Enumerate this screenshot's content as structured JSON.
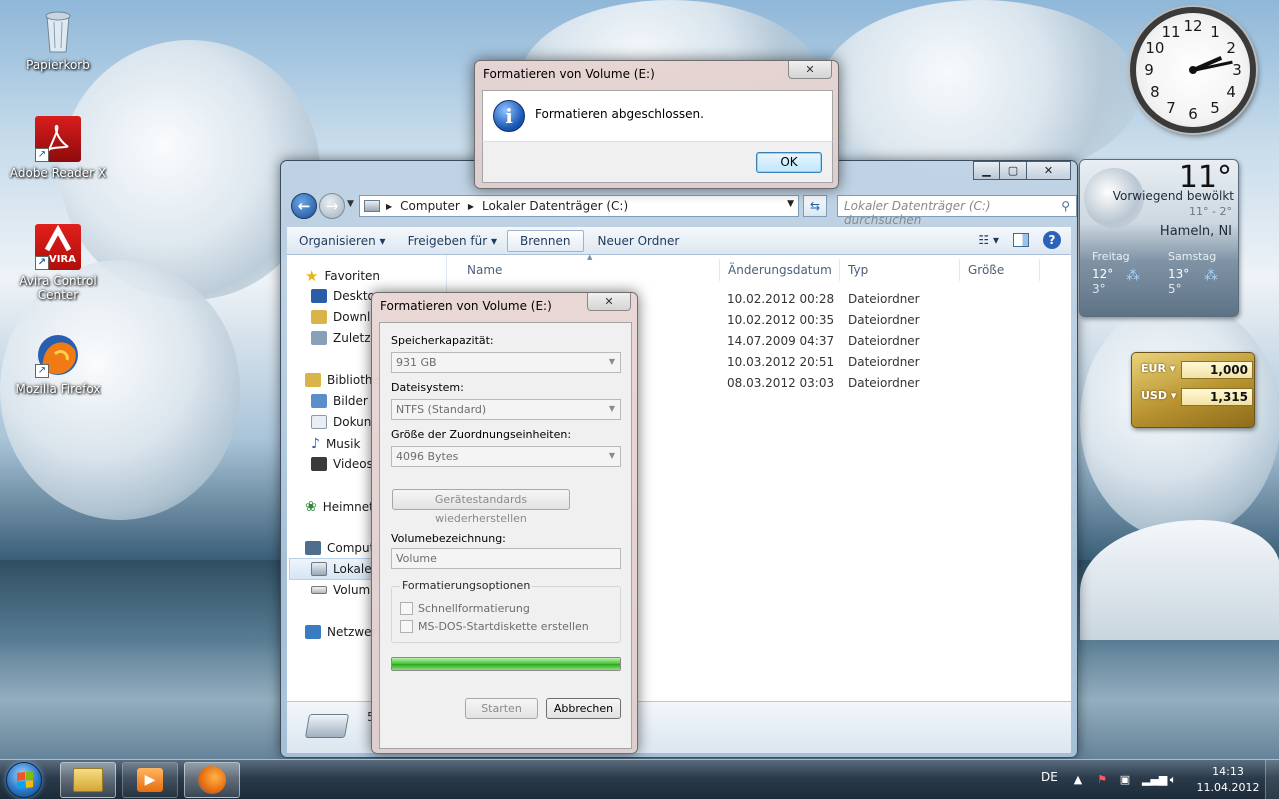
{
  "desktop": {
    "icons": [
      {
        "label": "Papierkorb",
        "icon": "recycle-bin-icon"
      },
      {
        "label": "Adobe Reader X",
        "icon": "adobe-reader-icon"
      },
      {
        "label": "Avira Control Center",
        "icon": "avira-icon",
        "badge": "VIRA"
      },
      {
        "label": "Mozilla Firefox",
        "icon": "firefox-icon"
      }
    ]
  },
  "explorer": {
    "address": {
      "parts": [
        "Computer",
        "Lokaler Datenträger (C:)"
      ]
    },
    "search_placeholder": "Lokaler Datenträger (C:) durchsuchen",
    "toolbar": {
      "organize": "Organisieren",
      "share": "Freigeben für",
      "burn": "Brennen",
      "new_folder": "Neuer Ordner"
    },
    "nav": {
      "favorites": "Favoriten",
      "desktop": "Deskto",
      "downloads": "Downl",
      "recent": "Zuletz",
      "libraries": "Bibliothe",
      "pictures": "Bilder",
      "documents": "Dokun",
      "music": "Musik",
      "videos": "Videos",
      "homegroup": "Heimnet",
      "computer": "Comput",
      "local_disk": "Lokale",
      "volume": "Volum",
      "network": "Netzwer"
    },
    "columns": {
      "name": "Name",
      "date": "Änderungsdatum",
      "type": "Typ",
      "size": "Größe"
    },
    "rows": [
      {
        "date": "10.02.2012 00:28",
        "type": "Dateiordner"
      },
      {
        "date": "10.02.2012 00:35",
        "type": "Dateiordner"
      },
      {
        "date": "14.07.2009 04:37",
        "type": "Dateiordner"
      },
      {
        "date": "10.03.2012 20:51",
        "type": "Dateiordner"
      },
      {
        "date": "08.03.2012 03:03",
        "type": "Dateiordner"
      }
    ],
    "status_count": "5"
  },
  "format_dialog": {
    "title": "Formatieren von Volume (E:)",
    "capacity_label": "Speicherkapazität:",
    "capacity_value": "931 GB",
    "filesystem_label": "Dateisystem:",
    "filesystem_value": "NTFS (Standard)",
    "alloc_label": "Größe der Zuordnungseinheiten:",
    "alloc_value": "4096 Bytes",
    "restore_defaults": "Gerätestandards wiederherstellen",
    "volume_label_label": "Volumebezeichnung:",
    "volume_label_value": "Volume",
    "options_group": "Formatierungsoptionen",
    "quick_format": "Schnellformatierung",
    "msdos_disk": "MS-DOS-Startdiskette erstellen",
    "progress": 1.0,
    "start": "Starten",
    "cancel": "Abbrechen"
  },
  "message_box": {
    "title": "Formatieren von Volume (E:)",
    "text": "Formatieren abgeschlossen.",
    "ok": "OK"
  },
  "clock": {
    "numbers": [
      "12",
      "1",
      "2",
      "3",
      "4",
      "5",
      "6",
      "7",
      "8",
      "9",
      "10",
      "11"
    ],
    "time": "14:13"
  },
  "weather": {
    "temp": "11°",
    "desc": "Vorwiegend bewölkt",
    "range": "11° - 2°",
    "city": "Hameln, NI",
    "day1": {
      "name": "Freitag",
      "high": "12°",
      "low": "3°"
    },
    "day2": {
      "name": "Samstag",
      "high": "13°",
      "low": "5°"
    }
  },
  "currency": {
    "row1": {
      "code": "EUR",
      "value": "1,000"
    },
    "row2": {
      "code": "USD",
      "value": "1,315"
    }
  },
  "taskbar": {
    "language": "DE",
    "time": "14:13",
    "date": "11.04.2012"
  }
}
